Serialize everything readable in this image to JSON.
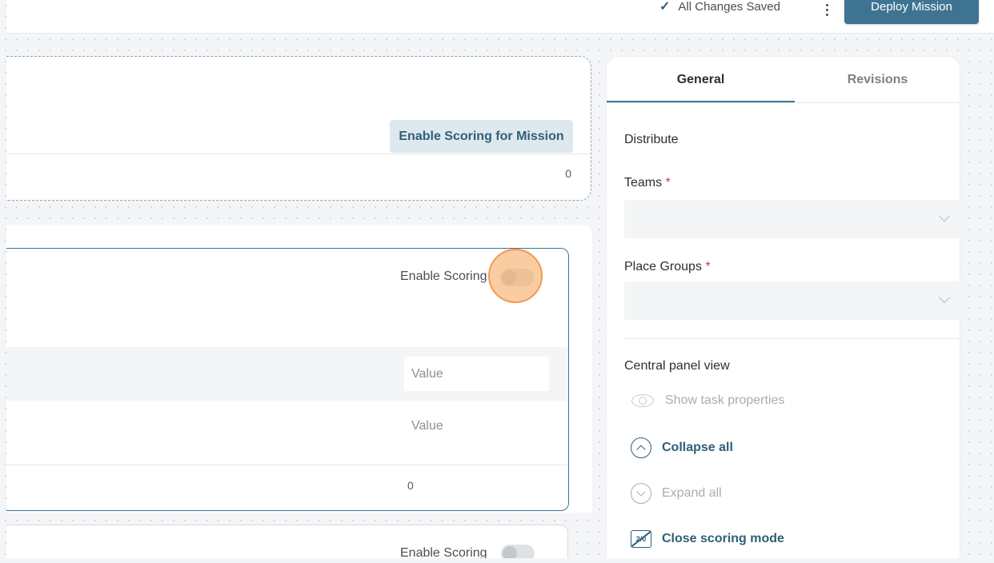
{
  "topbar": {
    "saved_status": "All Changes Saved",
    "deploy_label": "Deploy Mission"
  },
  "mission": {
    "enable_scoring_label": "Enable Scoring for Mission",
    "score_total": "0"
  },
  "tasks": [
    {
      "enable_scoring_label": "Enable Scoring",
      "scoring_enabled": false,
      "value_input_placeholder": "Value",
      "value_text": "Value",
      "score_total": "0"
    },
    {
      "enable_scoring_label": "Enable Scoring",
      "scoring_enabled": false
    }
  ],
  "panel": {
    "tabs": [
      {
        "label": "General",
        "active": true
      },
      {
        "label": "Revisions",
        "active": false
      }
    ],
    "distribute_heading": "Distribute",
    "teams_label": "Teams",
    "place_groups_label": "Place Groups",
    "required_mark": "*",
    "central_view_heading": "Central panel view",
    "actions": {
      "show_task_properties": "Show task properties",
      "collapse_all": "Collapse all",
      "expand_all": "Expand all",
      "close_scoring_mode": "Close scoring mode"
    },
    "score_icon_text": "2/0"
  },
  "colors": {
    "primary": "#3e7491",
    "primary_text": "#2f5f78",
    "required": "#d33b3b",
    "click_highlight": "#f19a52"
  },
  "icons": [
    "check-icon",
    "kebab-icon",
    "chevron-down-icon",
    "eye-icon",
    "chevron-up-circle-icon",
    "chevron-down-circle-icon",
    "score-off-icon"
  ]
}
